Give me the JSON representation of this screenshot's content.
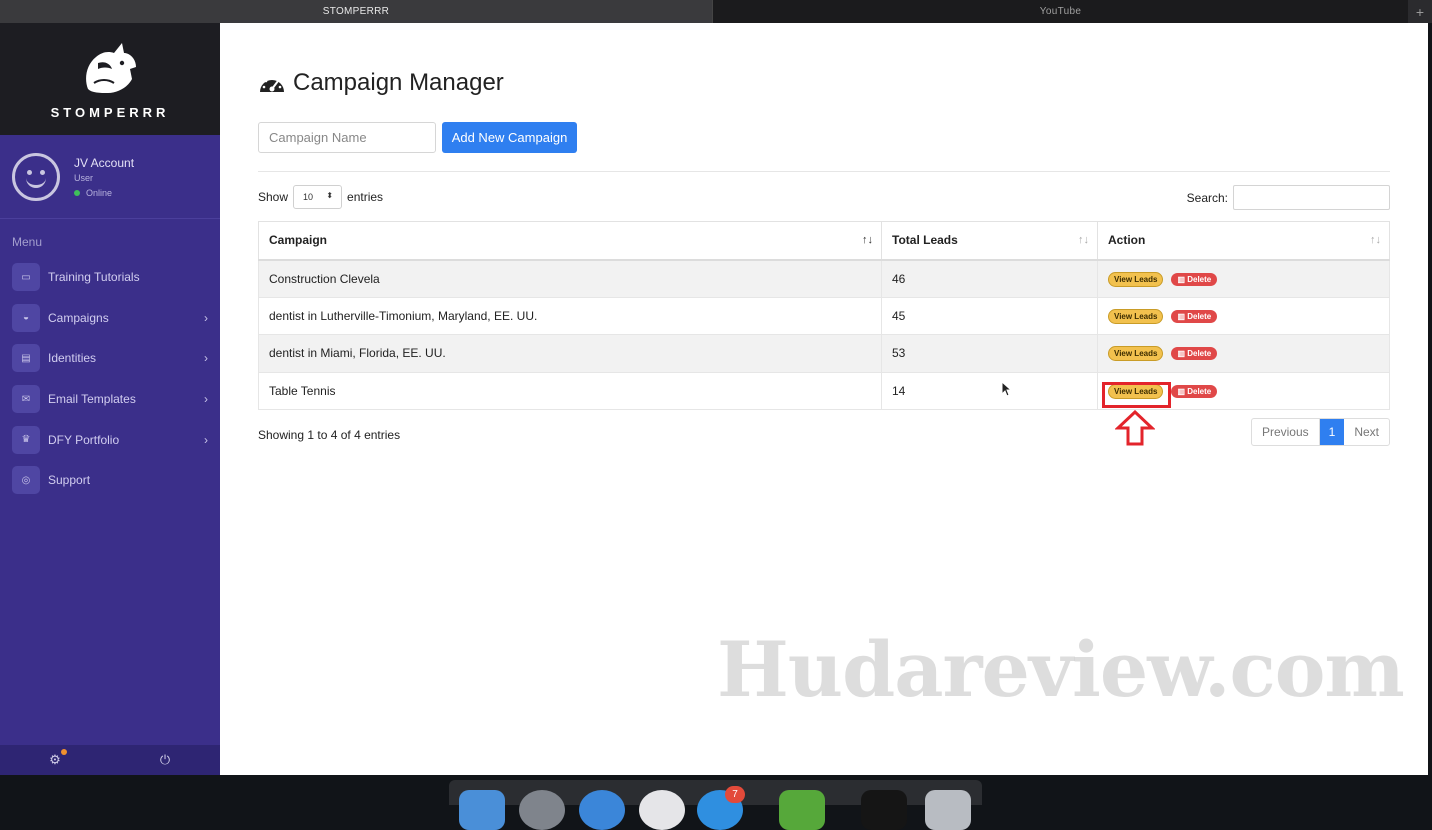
{
  "browser": {
    "tabs": [
      "STOMPERRR",
      "YouTube"
    ],
    "add_tab": "+"
  },
  "sidebar": {
    "brand": "STOMPERRR",
    "user": {
      "name": "JV Account",
      "role": "User",
      "status": "Online"
    },
    "menu_title": "Menu",
    "items": [
      {
        "label": "Training Tutorials",
        "icon": "tutorials-icon",
        "chevron": ""
      },
      {
        "label": "Campaigns",
        "icon": "dashboard-icon",
        "chevron": "›"
      },
      {
        "label": "Identities",
        "icon": "id-card-icon",
        "chevron": "›"
      },
      {
        "label": "Email Templates",
        "icon": "envelope-icon",
        "chevron": "›"
      },
      {
        "label": "DFY Portfolio",
        "icon": "crown-icon",
        "chevron": "›"
      },
      {
        "label": "Support",
        "icon": "life-ring-icon",
        "chevron": ""
      }
    ],
    "footer": {
      "settings": "⚙",
      "power": "⏻"
    }
  },
  "main": {
    "title": "Campaign Manager",
    "campaign_input": {
      "placeholder": "Campaign Name",
      "value": ""
    },
    "add_button": "Add New Campaign",
    "show_label": "Show",
    "entries_select": "10",
    "entries_label": "entries",
    "search_label": "Search:",
    "table": {
      "headers": [
        "Campaign",
        "Total Leads",
        "Action"
      ],
      "rows": [
        {
          "campaign": "Construction Clevela",
          "leads": "46"
        },
        {
          "campaign": "dentist in Lutherville-Timonium, Maryland, EE. UU.",
          "leads": "45"
        },
        {
          "campaign": "dentist in Miami, Florida, EE. UU.",
          "leads": "53"
        },
        {
          "campaign": "Table Tennis",
          "leads": "14"
        }
      ],
      "view_label": "View Leads",
      "delete_label": "Delete"
    },
    "showing": "Showing 1 to 4 of 4 entries",
    "pagination": {
      "prev": "Previous",
      "current": "1",
      "next": "Next"
    }
  },
  "watermark": "Hudareview.com",
  "dock": {
    "badge": "7"
  },
  "colors": {
    "sidebar": "#3b2f8a",
    "primary": "#2f7ff0",
    "view": "#f2c14e",
    "delete": "#e04848",
    "highlight": "#e3242b"
  }
}
